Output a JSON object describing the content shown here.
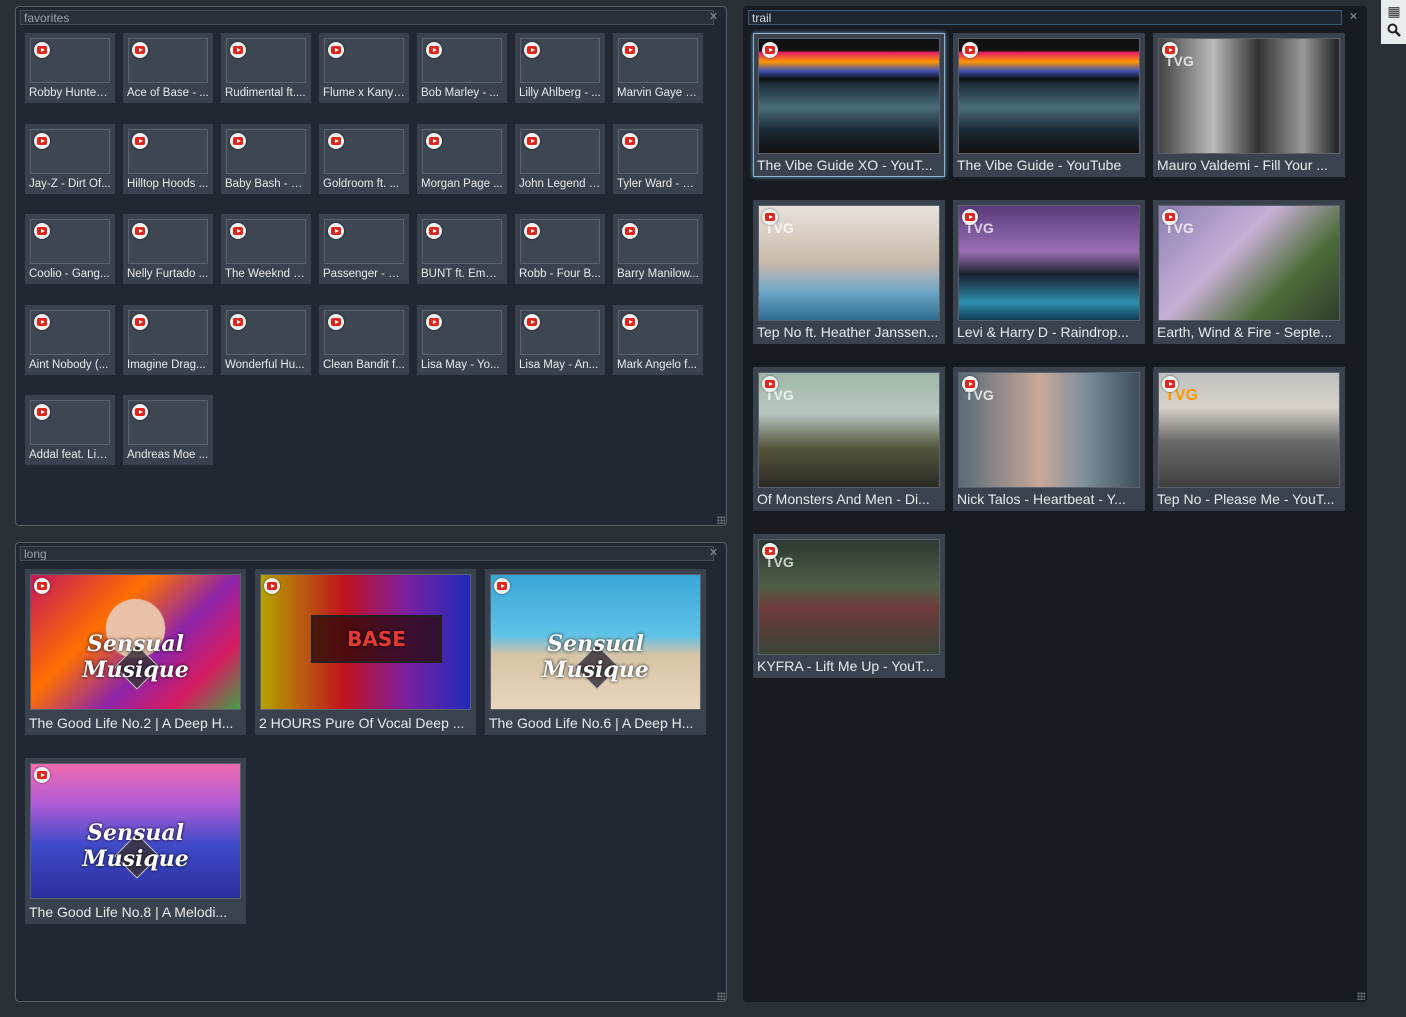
{
  "panels": {
    "favorites": {
      "title": "favorites"
    },
    "long": {
      "title": "long"
    },
    "trail": {
      "title": "trail"
    }
  },
  "favorites_items": [
    "Robby Hunter ...",
    "Ace of Base - ...",
    "Rudimental ft....",
    "Flume x Kanye...",
    "Bob Marley - ...",
    "Lilly Ahlberg - ...",
    "Marvin Gaye - ...",
    "Jay-Z - Dirt Of...",
    "Hilltop Hoods ...",
    "Baby Bash - S...",
    "Goldroom ft. ...",
    "Morgan Page ...",
    "John Legend -...",
    "Tyler Ward - O...",
    "Coolio - Gang...",
    "Nelly Furtado ...",
    "The Weeknd - ...",
    "Passenger - Le...",
    "BUNT ft. Emm...",
    "Robb - Four B...",
    "Barry Manilow...",
    "Aint Nobody (...",
    "Imagine Drag...",
    "Wonderful Hu...",
    "Clean Bandit f...",
    "Lisa May - Yo...",
    "Lisa May - An...",
    "Mark Angelo f...",
    "Addal feat. Lis...",
    "Andreas Moe ..."
  ],
  "long_items": [
    {
      "caption": "The Good Life No.2 | A Deep H...",
      "overlay": "Sensual Musique",
      "bg": "flowers"
    },
    {
      "caption": "2 HOURS Pure Of Vocal Deep ...",
      "overlay": "BASE",
      "bg": "base"
    },
    {
      "caption": "The Good Life No.6 | A Deep H...",
      "overlay": "Sensual Musique",
      "bg": "beach"
    },
    {
      "caption": "The Good Life No.8 | A Melodi...",
      "overlay": "Sensual Musique",
      "bg": "sunset"
    }
  ],
  "trail_items": [
    {
      "caption": "The Vibe Guide XO - YouT...",
      "bg": "site"
    },
    {
      "caption": "The Vibe Guide - YouTube",
      "bg": "site"
    },
    {
      "caption": "Mauro Valdemi - Fill Your ...",
      "bg": "bw"
    },
    {
      "caption": "Tep No ft. Heather Janssen...",
      "bg": "pool"
    },
    {
      "caption": "Levi & Harry D - Raindrop...",
      "bg": "palms"
    },
    {
      "caption": "Earth, Wind & Fire - Septe...",
      "bg": "street"
    },
    {
      "caption": "Of Monsters And Men - Di...",
      "bg": "city"
    },
    {
      "caption": "Nick Talos - Heartbeat - Y...",
      "bg": "portrait"
    },
    {
      "caption": "Tep No - Please Me - YouT...",
      "bg": "road"
    },
    {
      "caption": "KYFRA - Lift Me Up - YouT...",
      "bg": "forest"
    }
  ],
  "thumb_text": {
    "tvg": "TVG"
  },
  "tools": {
    "layout_icon": "grid-layout-icon",
    "search_icon": "search-icon"
  },
  "colors": {
    "bg": "#2b2f36",
    "panel": "#222831",
    "tile": "#3a424d",
    "youtube_red": "#e2231a",
    "selected": "#8fb3d0"
  }
}
